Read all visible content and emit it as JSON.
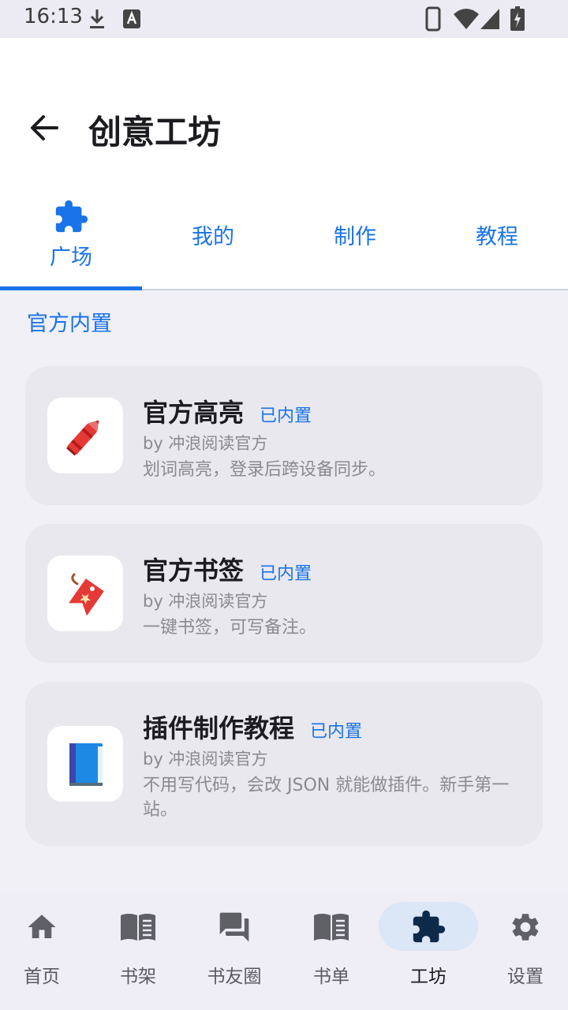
{
  "status_bar": {
    "time": "16:13",
    "icons": [
      "download-icon",
      "font-a-icon",
      "phone-icon",
      "wifi-icon",
      "signal-icon",
      "battery-charging-icon"
    ]
  },
  "header": {
    "back_icon": "arrow-left-icon",
    "title": "创意工坊"
  },
  "tabs": [
    {
      "label": "广场",
      "icon": "puzzle-icon",
      "active": true
    },
    {
      "label": "我的",
      "active": false
    },
    {
      "label": "制作",
      "active": false
    },
    {
      "label": "教程",
      "active": false
    }
  ],
  "section": {
    "title": "官方内置"
  },
  "cards": [
    {
      "title": "官方高亮",
      "badge": "已内置",
      "author": "by 冲浪阅读官方",
      "description": "划词高亮，登录后跨设备同步。",
      "icon": "crayon-icon"
    },
    {
      "title": "官方书签",
      "badge": "已内置",
      "author": "by 冲浪阅读官方",
      "description": "一键书签，可写备注。",
      "icon": "bookmark-tag-icon"
    },
    {
      "title": "插件制作教程",
      "badge": "已内置",
      "author": "by 冲浪阅读官方",
      "description": "不用写代码，会改 JSON 就能做插件。新手第一站。",
      "icon": "blue-book-icon"
    }
  ],
  "bottom_nav": [
    {
      "label": "首页",
      "icon": "home-icon",
      "active": false
    },
    {
      "label": "书架",
      "icon": "book-open-icon",
      "active": false
    },
    {
      "label": "书友圈",
      "icon": "forum-icon",
      "active": false
    },
    {
      "label": "书单",
      "icon": "book-open-icon",
      "active": false
    },
    {
      "label": "工坊",
      "icon": "puzzle-icon",
      "active": true
    },
    {
      "label": "设置",
      "icon": "gear-icon",
      "active": false
    }
  ],
  "colors": {
    "accent": "#1a73e8",
    "nav_active_pill": "#dbe6f7",
    "card_background": "#e8e8ee",
    "page_background": "#f1f0f6"
  }
}
